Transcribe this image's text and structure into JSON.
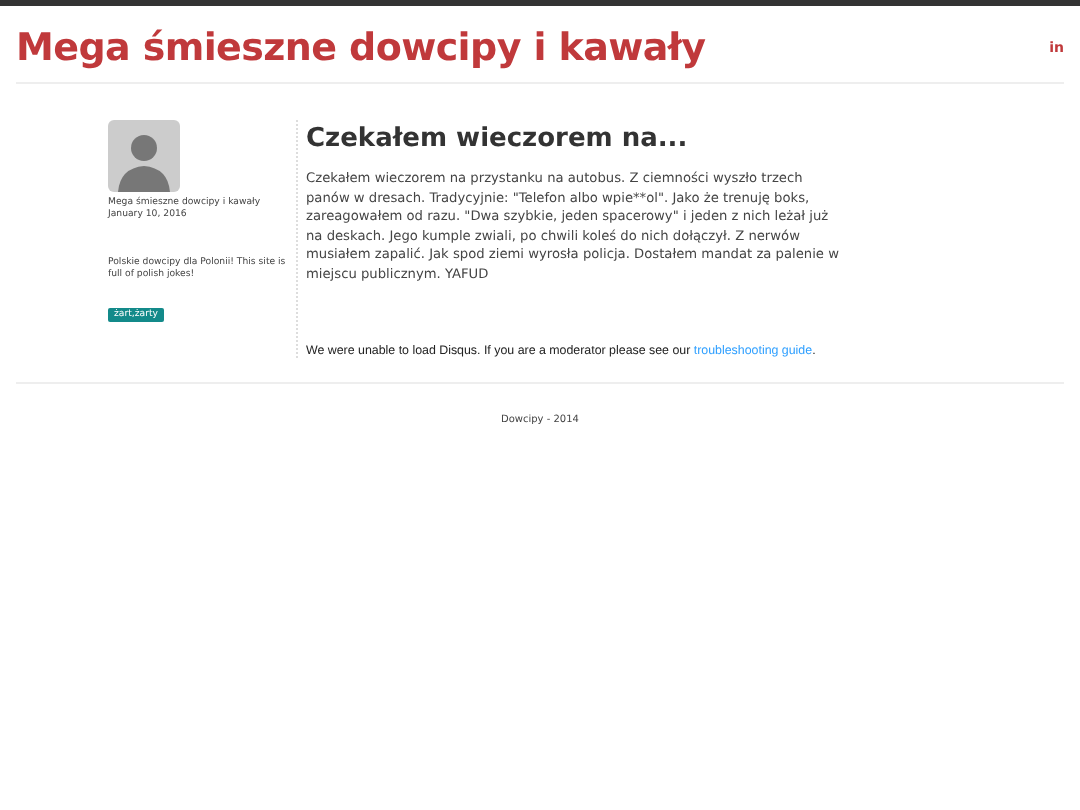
{
  "header": {
    "title": "Mega śmieszne dowcipy i kawały",
    "social_icon": "in"
  },
  "sidebar": {
    "author": "Mega śmieszne dowcipy i kawały",
    "date": "January 10, 2016",
    "description": "Polskie dowcipy dla Polonii! This site is full of polish jokes!",
    "tag": "żart,żarty"
  },
  "post": {
    "title": "Czekałem wieczorem na...",
    "body": "Czekałem wieczorem na przystanku na autobus. Z ciemności wyszło trzech panów w dresach. Tradycyjnie: \"Telefon albo wpie**ol\". Jako że trenuję boks, zareagowałem od razu. \"Dwa szybkie, jeden spacerowy\" i jeden z nich leżał już na deskach. Jego kumple zwiali, po chwili koleś do nich dołączył. Z nerwów musiałem zapalić. Jak spod ziemi wyrosła policja. Dostałem mandat za palenie w miejscu publicznym. YAFUD"
  },
  "comments": {
    "message": "We were unable to load Disqus. If you are a moderator please see our",
    "link": "troubleshooting guide",
    "end": "."
  },
  "footer": {
    "text": "Dowcipy - 2014"
  }
}
